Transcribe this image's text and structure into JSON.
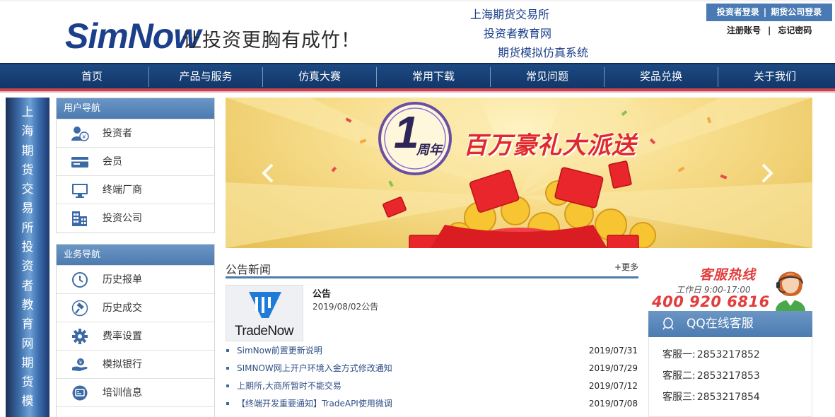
{
  "header": {
    "logo_text": "SimNow",
    "slogan": "让投资更胸有成竹！",
    "org_lines": [
      "上海期货交易所",
      "投资者教育网",
      "期货模拟仿真系统"
    ],
    "investor_login": "投资者登录",
    "company_login": "期货公司登录",
    "login_separator": "|",
    "register": "注册账号",
    "account_separator": "|",
    "forgot_password": "忘记密码"
  },
  "nav": {
    "items": [
      "首页",
      "产品与服务",
      "仿真大赛",
      "常用下载",
      "常见问题",
      "奖品兑换",
      "关于我们"
    ]
  },
  "vertical_banner": {
    "text": "上海期货交易所投资者教育网期货模"
  },
  "user_nav": {
    "title": "用户导航",
    "items": [
      {
        "label": "投资者",
        "icon": "investor-icon"
      },
      {
        "label": "会员",
        "icon": "member-card-icon"
      },
      {
        "label": "终端厂商",
        "icon": "monitor-icon"
      },
      {
        "label": "投资公司",
        "icon": "building-icon"
      }
    ]
  },
  "business_nav": {
    "title": "业务导航",
    "items": [
      {
        "label": "历史报单",
        "icon": "clock-icon"
      },
      {
        "label": "历史成交",
        "icon": "gavel-icon"
      },
      {
        "label": "费率设置",
        "icon": "gear-icon"
      },
      {
        "label": "模拟银行",
        "icon": "money-hand-icon"
      },
      {
        "label": "培训信息",
        "icon": "training-icon"
      }
    ]
  },
  "carousel": {
    "badge_number": "1",
    "badge_label": "周年",
    "headline": "百万豪礼大派送",
    "prev_icon": "chevron-left-icon",
    "next_icon": "chevron-right-icon"
  },
  "news": {
    "title": "公告新闻",
    "more": "+更多",
    "featured": {
      "thumb_text": "TradeNow",
      "title": "公告",
      "subtitle": "2019/08/02公告"
    },
    "items": [
      {
        "text": "SimNow前置更新说明",
        "date": "2019/07/31"
      },
      {
        "text": "SIMNOW网上开户环境入金方式修改通知",
        "date": "2019/07/29"
      },
      {
        "text": "上期所,大商所暂时不能交易",
        "date": "2019/07/12"
      },
      {
        "text": "【终端开发重要通知】TradeAPI使用微调",
        "date": "2019/07/08"
      }
    ]
  },
  "hotline": {
    "title": "客服热线",
    "hours": "工作日 9:00-17:00",
    "phone": "400 920 6816",
    "qq_label": "QQ在线客服",
    "qq_lines": [
      {
        "label": "客服一:",
        "number": "2853217852"
      },
      {
        "label": "客服二:",
        "number": "2853217853"
      },
      {
        "label": "客服三:",
        "number": "2853217854"
      }
    ]
  },
  "colors": {
    "nav_bg": "#123669",
    "accent_red": "#c9434f",
    "panel_blue": "#4c7bb0",
    "hotline_red": "#e33c3c"
  }
}
